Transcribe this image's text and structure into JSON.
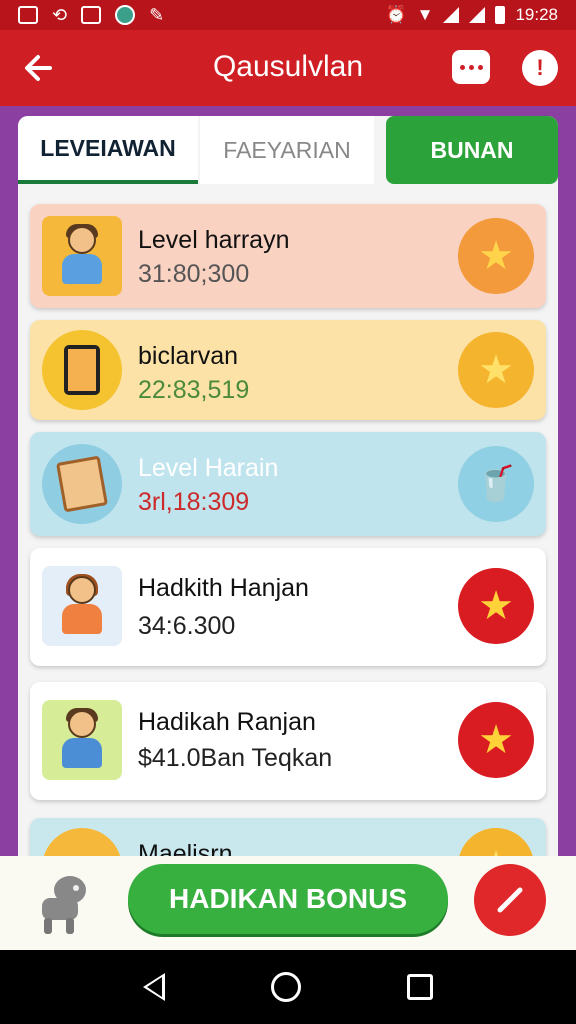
{
  "status_bar": {
    "time": "19:28",
    "icons": [
      "app-icon",
      "sync-icon",
      "window-icon",
      "globe-icon",
      "edit-icon",
      "alarm-icon",
      "wifi-icon",
      "signal-icon",
      "battery-icon"
    ]
  },
  "app_bar": {
    "title": "Qausulvlan",
    "back_icon": "arrow-left-icon",
    "chat_icon": "chat-icon",
    "info_icon": "info-icon"
  },
  "tabs": [
    {
      "label": "LEVEIAWAN",
      "active": true
    },
    {
      "label": "FAEYARIAN",
      "active": false
    },
    {
      "label": "BUNAN",
      "active": false
    }
  ],
  "items": [
    {
      "title": "Level harrayn",
      "value": "31:80;300",
      "bg": "#fad2c2",
      "badge_color": "#f29a3c",
      "badge_icon": "star-icon"
    },
    {
      "title": "biclarvan",
      "value": "22:83,519",
      "bg": "#fce2a6",
      "badge_color": "#f5b42e",
      "badge_icon": "star-icon"
    },
    {
      "title": "Level Harain",
      "value": "3rl,18:309",
      "bg": "#bfe4ee",
      "badge_color": "#8fd0e4",
      "badge_icon": "drink-icon"
    },
    {
      "title": "Hadkith Hanjan",
      "value": "34:6.300",
      "bg": "#ffffff",
      "badge_color": "#d91c22",
      "badge_icon": "star-icon"
    },
    {
      "title": "Hadikah Ranjan",
      "value": "$41.0Ban Teqkan",
      "bg": "#ffffff",
      "badge_color": "#d91c22",
      "badge_icon": "star-icon"
    },
    {
      "title": "Maelisrn",
      "value": "",
      "bg": "#c9e8ee",
      "badge_color": "#f5b42e",
      "badge_icon": "star-icon"
    }
  ],
  "bottom": {
    "bonus_label": "HADIKAN BONUS",
    "robot_icon": "robot-icon",
    "edit_icon": "pencil-icon"
  },
  "colors": {
    "primary": "#cf1f24",
    "accent_green": "#37b040",
    "purple_bg": "#8b3fa0"
  }
}
